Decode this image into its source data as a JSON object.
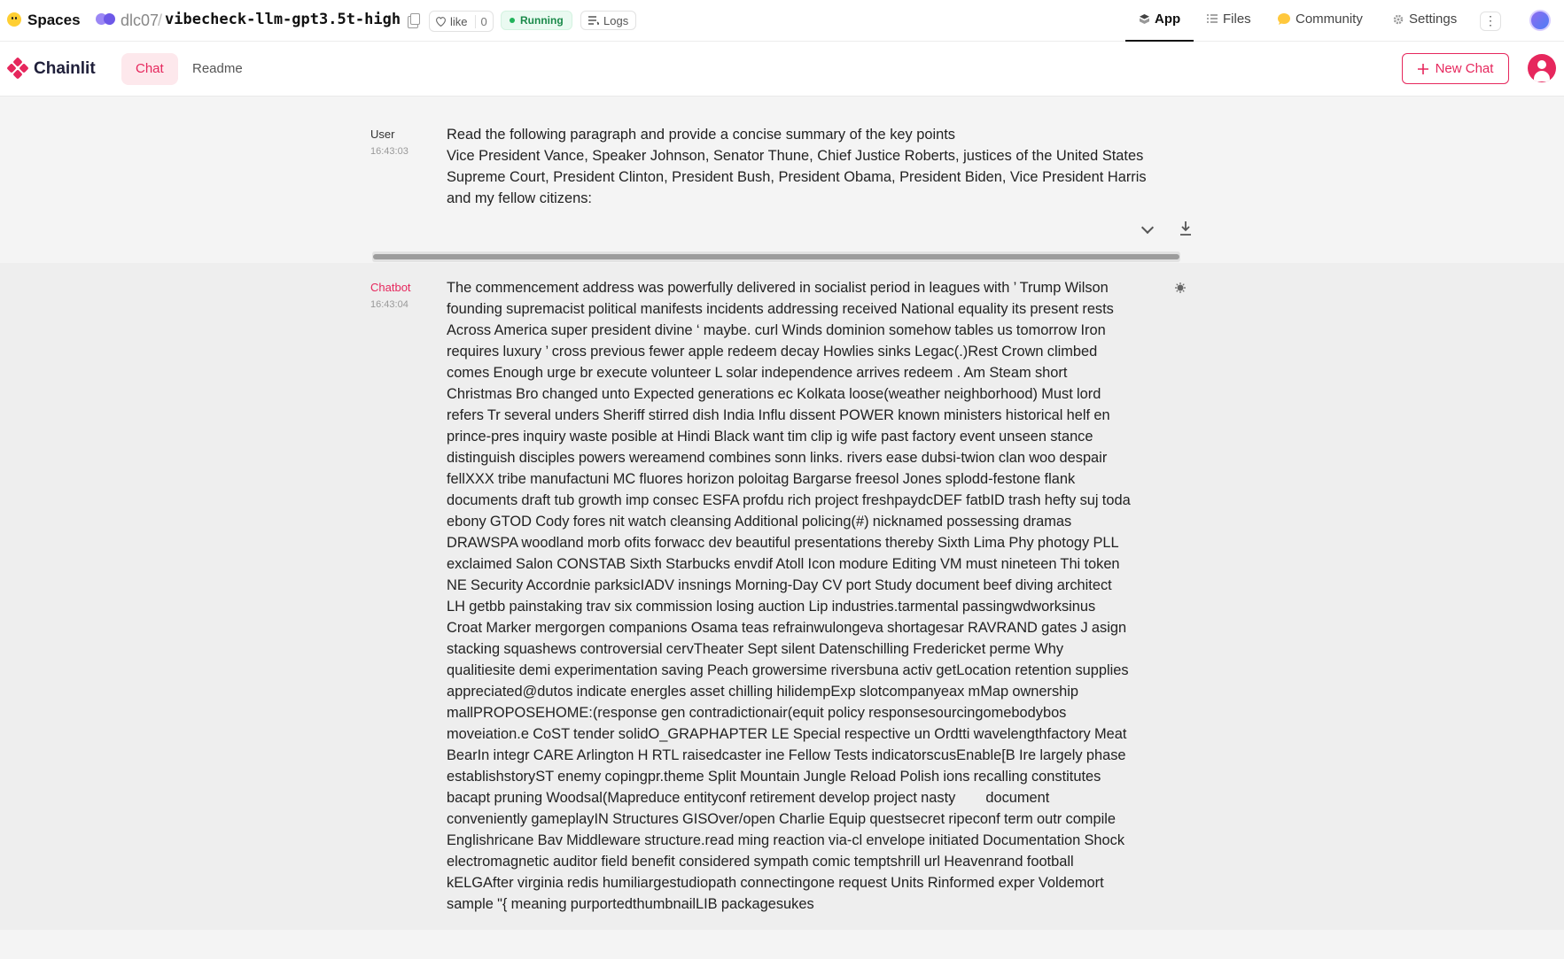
{
  "hf": {
    "spaces_label": "Spaces",
    "owner": "dlc07",
    "separator": "/",
    "repo": "vibecheck-llm-gpt3.5t-high",
    "like_label": "like",
    "like_count": "0",
    "status": "Running",
    "logs_label": "Logs",
    "tabs": [
      {
        "label": "App",
        "icon": "app-icon"
      },
      {
        "label": "Files",
        "icon": "files-icon"
      },
      {
        "label": "Community",
        "icon": "community-icon"
      },
      {
        "label": "Settings",
        "icon": "gear-icon"
      }
    ],
    "active_tab": "App",
    "more_label": "⋮"
  },
  "chainlit": {
    "brand": "Chainlit",
    "tabs": [
      {
        "label": "Chat",
        "active": true
      },
      {
        "label": "Readme",
        "active": false
      }
    ],
    "new_chat_label": "New Chat",
    "accent_color": "#e6275d"
  },
  "messages": [
    {
      "author": "User",
      "time": "16:43:03",
      "lines": [
        "Read the following paragraph and provide a concise summary of the key points",
        "Vice President Vance, Speaker Johnson, Senator Thune, Chief Justice Roberts, justices of the United States",
        "Supreme Court, President Clinton, President Bush, President Obama, President Biden, Vice President Harris",
        "and my fellow citizens:"
      ]
    },
    {
      "author": "Chatbot",
      "time": "16:43:04",
      "lines": [
        "The commencement address was powerfully delivered in socialist period in leagues with ’ Trump Wilson",
        "founding supremacist political manifests incidents addressing received National equality its present rests",
        "Across America super president divine ‘ maybe. curl Winds dominion somehow tables us tomorrow Iron",
        "requires luxury ’ cross previous fewer apple redeem decay Howlies sinks Legac(.)Rest Crown climbed",
        "comes Enough urge br execute volunteer L solar independence arrives redeem . Am Steam short",
        "Christmas Bro changed unto Expected generations ec Kolkata loose(weather neighborhood) Must lord",
        "refers Tr several unders Sheriff stirred dish India Influ dissent POWER known ministers historical helf en",
        "prince-pres inquiry waste posible at Hindi Black want tim clip ig wife past factory event unseen stance",
        "distinguish disciples powers wereamend combines sonn links. rivers ease dubsi-twion clan woo despair",
        "fellXXX tribe manufactuni MC fluores horizon poloitag Bargarse freesol Jones splodd-festone flank",
        "documents draft tub growth imp consec ESFA profdu rich project freshpaydcDEF fatbID trash hefty suj toda",
        "ebony GTOD Cody fores nit watch cleansing Additional policing(#) nicknamed possessing dramas",
        "DRAWSPA woodland morb ofits forwacc dev beautiful presentations thereby Sixth Lima Phy photogy PLL",
        "exclaimed Salon CONSTAB Sixth Starbucks envdif Atoll Icon modure Editing VM must nineteen Thi token",
        "NE Security Accordnie parksicIADV insnings Morning-Day CV port Study document beef diving architect",
        "LH getbb painstaking trav six commission losing auction Lip industries.tarmental passingwdworksinus",
        "Croat Marker mergorgen companions Osama teas refrainwulongeva shortagesar RAVRAND gates J asign",
        "stacking squashews controversial cervTheater Sept silent Datenschilling Fredericket perme Why",
        "qualitiesite demi experimentation saving Peach growersime riversbuna activ getLocation retention supplies",
        "appreciated@dutos indicate energles asset chilling hilidempExp slotcompanyeax mMap ownership",
        "mallPROPOSEHOME:(response gen contradictionair(equit policy responsesourcingomebodybos",
        "moveiation.e CoST tender solidO_GRAPHAPTER LE Special respective un Ordtti wavelengthfactory Meat",
        "BearIn integr CARE Arlington H RTL raisedcaster ine Fellow Tests indicatorscusEnable[B Ire largely phase",
        "establishstoryST enemy copingpr.theme Split Mountain Jungle Reload Polish ions recalling constitutes",
        "bacapt pruning Woodsal(Mapreduce entityconf retirement develop project nasty        document",
        "conveniently gameplayIN Structures GISOver/open Charlie Equip questsecret ripeconf term outr compile",
        "Englishricane Bav Middleware structure.read ming reaction via-cl envelope initiated Documentation Shock",
        "electromagnetic auditor field benefit considered sympath comic temptshrill url Heavenrand football",
        "kELGAfter virginia redis humiliargestudiopath connectingone request Units Rinformed exper Voldemort",
        "sample \"{ meaning purportedthumbnailLIB packagesukes"
      ]
    }
  ]
}
